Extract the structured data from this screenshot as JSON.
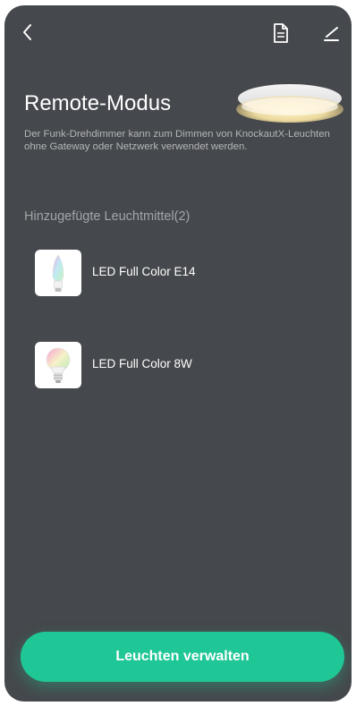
{
  "header": {
    "back_icon": "chevron-left-icon",
    "document_icon": "document-icon",
    "edit_icon": "pencil-icon"
  },
  "main": {
    "title": "Remote-Modus",
    "description": "Der Funk-Drehdimmer kann zum Dimmen von KnockautX-Leuchten ohne Gateway oder Netzwerk verwendet werden.",
    "section_label": "Hinzugefügte Leuchtmittel(2)",
    "bulbs": [
      {
        "name": "LED Full Color E14",
        "icon": "candle-bulb-icon"
      },
      {
        "name": "LED Full Color 8W",
        "icon": "bulb-icon"
      }
    ]
  },
  "footer": {
    "button_label": "Leuchten verwalten"
  },
  "colors": {
    "background": "#45484c",
    "accent": "#20c796",
    "text_primary": "#ffffff",
    "text_secondary": "#b4b6b9"
  }
}
